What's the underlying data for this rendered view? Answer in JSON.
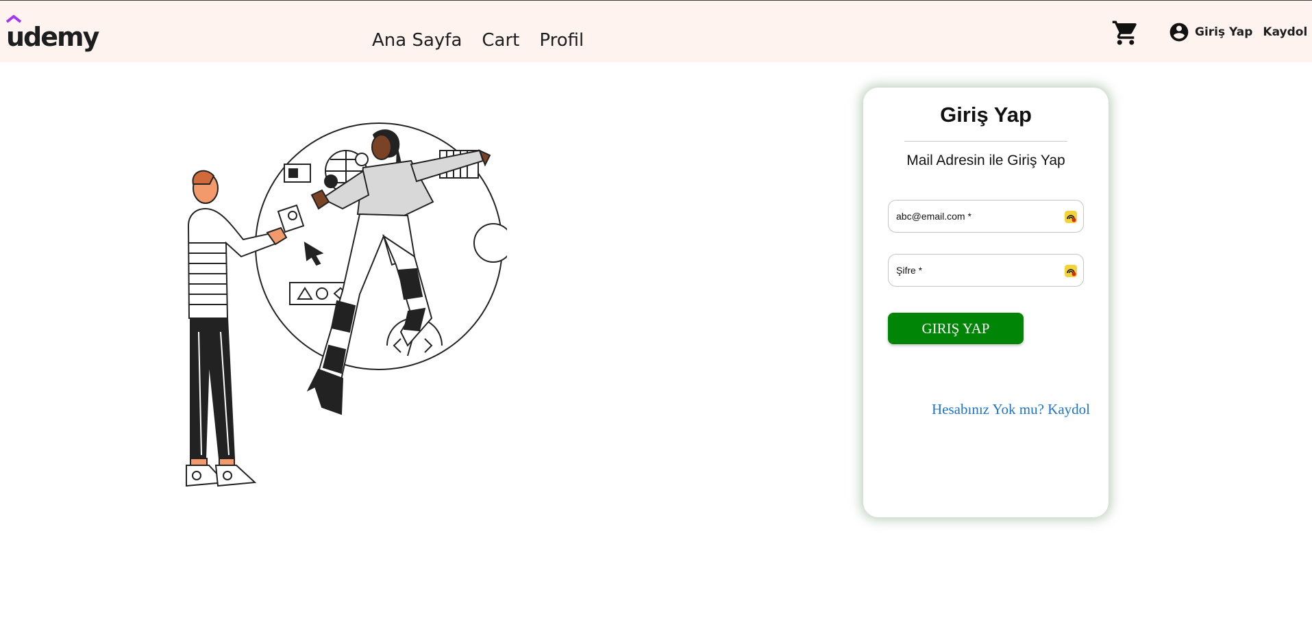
{
  "navbar": {
    "logo": "udemy",
    "links": [
      "Ana Sayfa",
      "Cart",
      "Profil"
    ],
    "cart_icon": "shopping-cart-icon",
    "user_icon": "account-circle-icon",
    "login_label": "Giriş Yap",
    "signup_label": "Kaydol"
  },
  "illustration": {
    "icon": "learning-people-illustration"
  },
  "login_card": {
    "title": "Giriş Yap",
    "subtitle": "Mail Adresin ile Giriş Yap",
    "email_label": "abc@email.com *",
    "password_label": "Şifre *",
    "field_badge_icon": "password-manager-icon",
    "submit_label": "GIRIŞ YAP",
    "register_link": "Hesabınız Yok mu? Kaydol"
  },
  "colors": {
    "navbar_bg": "#fef3ef",
    "button_green": "#008506",
    "link_blue": "#1e74c9",
    "logo_purple": "#a435f0"
  }
}
